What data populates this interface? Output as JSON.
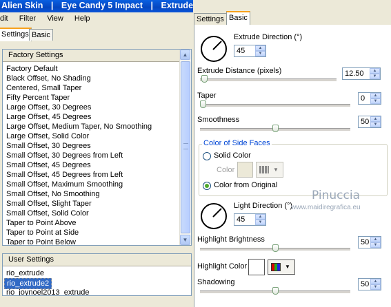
{
  "window": {
    "title_parts": [
      "Alien Skin",
      "|",
      "Eye Candy 5 Impact",
      "|",
      "Extrude"
    ]
  },
  "menu": [
    "dit",
    "Filter",
    "View",
    "Help"
  ],
  "left_tabs": [
    {
      "label": "Settings",
      "active": true
    },
    {
      "label": "Basic",
      "active": false
    }
  ],
  "factory_settings": {
    "header": "Factory Settings",
    "items": [
      "Factory Default",
      "Black Offset, No Shading",
      "Centered, Small Taper",
      "Fifty Percent Taper",
      "Large Offset, 30 Degrees",
      "Large Offset, 45 Degrees",
      "Large Offset, Medium Taper, No Smoothing",
      "Large Offset, Solid Color",
      "Small Offset, 30 Degrees",
      "Small Offset, 30 Degrees from Left",
      "Small Offset, 45 Degrees",
      "Small Offset, 45 Degrees from Left",
      "Small Offset, Maximum Smoothing",
      "Small Offset, No Smoothing",
      "Small Offset, Slight Taper",
      "Small Offset, Solid Color",
      "Taper to Point Above",
      "Taper to Point at Side",
      "Taper to Point Below"
    ]
  },
  "user_settings": {
    "header": "User Settings",
    "items": [
      "rio_extrude",
      "rio_extrude2",
      "rio_joynoel2013_extrude"
    ],
    "selected_index": 1
  },
  "right_tabs": [
    {
      "label": "Settings",
      "active": false
    },
    {
      "label": "Basic",
      "active": true
    }
  ],
  "controls": {
    "extrude_direction": {
      "label": "Extrude Direction (°)",
      "value": "45"
    },
    "extrude_distance": {
      "label": "Extrude Distance (pixels)",
      "value": "12.50",
      "level": 0.01
    },
    "taper": {
      "label": "Taper",
      "value": "0",
      "level": 0.0
    },
    "smoothness": {
      "label": "Smoothness",
      "value": "50",
      "level": 0.5
    },
    "side_faces": {
      "group_label": "Color of Side Faces",
      "solid_label": "Solid Color",
      "color_label": "Color",
      "original_label": "Color from Original",
      "selected": "original"
    },
    "light_direction": {
      "label": "Light Direction (°)",
      "value": "45"
    },
    "highlight_brightness": {
      "label": "Highlight Brightness",
      "value": "50",
      "level": 0.5
    },
    "highlight_color": {
      "label": "Highlight Color"
    },
    "shadowing": {
      "label": "Shadowing",
      "value": "50",
      "level": 0.5
    }
  },
  "watermark": {
    "line1": "Pinuccia",
    "line2": "www.maidiregrafica.eu"
  },
  "colors": {
    "titlebar": "#0a54d8",
    "selection": "#316ac5",
    "tab_accent": "#f7a11b",
    "radio_on": "#4ea82c"
  }
}
